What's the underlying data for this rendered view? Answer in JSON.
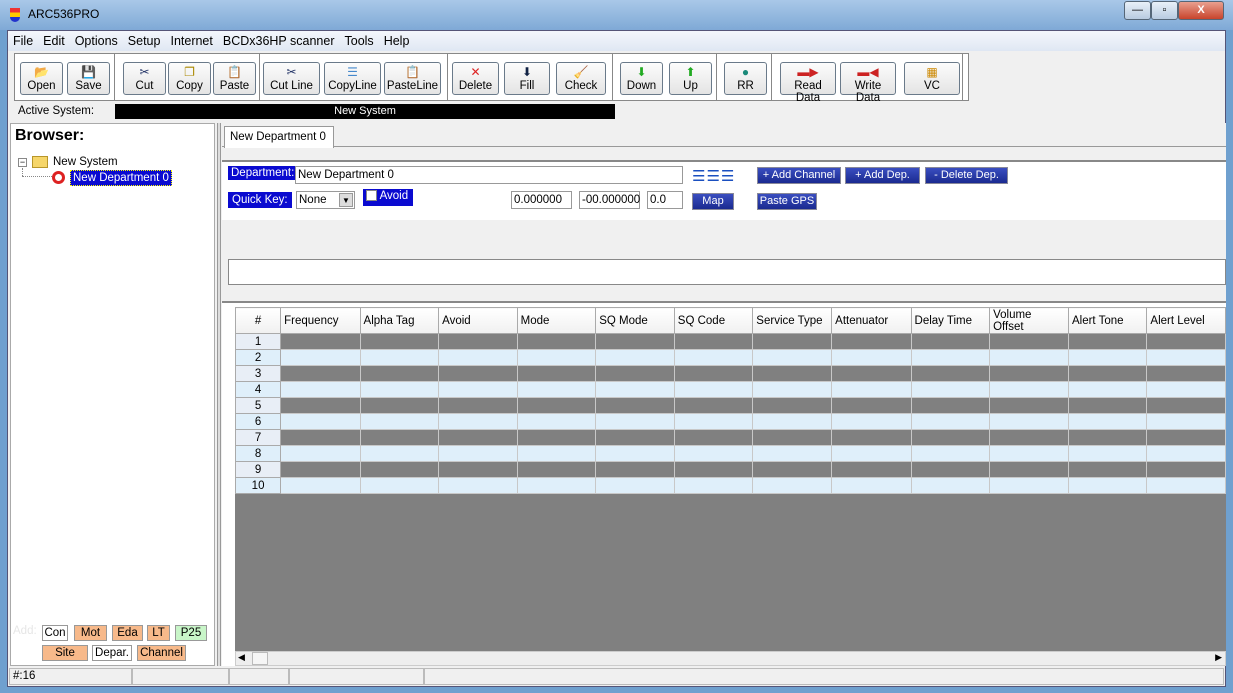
{
  "window": {
    "title": "ARC536PRO",
    "min": "—",
    "max": "▫",
    "close": "X"
  },
  "menu": [
    "File",
    "Edit",
    "Options",
    "Setup",
    "Internet",
    "BCDx36HP scanner",
    "Tools",
    "Help"
  ],
  "toolbar": [
    {
      "label": "Open",
      "icon": "folder-open-icon",
      "glyph": "📂"
    },
    {
      "label": "Save",
      "icon": "floppy-icon",
      "glyph": "💾"
    },
    {
      "label": "Cut",
      "icon": "scissors-icon",
      "glyph": "✂"
    },
    {
      "label": "Copy",
      "icon": "copy-icon",
      "glyph": "❐"
    },
    {
      "label": "Paste",
      "icon": "paste-icon",
      "glyph": "📋"
    },
    {
      "label": "Cut Line",
      "icon": "cut-line-icon",
      "glyph": "✂"
    },
    {
      "label": "CopyLine",
      "icon": "copy-line-icon",
      "glyph": "☰"
    },
    {
      "label": "PasteLine",
      "icon": "paste-line-icon",
      "glyph": "📋"
    },
    {
      "label": "Delete",
      "icon": "delete-x-icon",
      "glyph": "✕"
    },
    {
      "label": "Fill",
      "icon": "fill-down-icon",
      "glyph": "⬇"
    },
    {
      "label": "Check",
      "icon": "check-broom-icon",
      "glyph": "🧹"
    },
    {
      "label": "Down",
      "icon": "arrow-down-icon",
      "glyph": "⬇"
    },
    {
      "label": "Up",
      "icon": "arrow-up-icon",
      "glyph": "⬆"
    },
    {
      "label": "RR",
      "icon": "globe-icon",
      "glyph": "●"
    },
    {
      "label": "Read Data",
      "icon": "read-data-icon",
      "glyph": "▬▶"
    },
    {
      "label": "Write Data",
      "icon": "write-data-icon",
      "glyph": "▬◀"
    },
    {
      "label": "VC",
      "icon": "vc-grid-icon",
      "glyph": "▦"
    }
  ],
  "active_system": {
    "label": "Active System:",
    "value": "New System"
  },
  "browser": {
    "title": "Browser:",
    "tree": {
      "root": "New System",
      "child": "New Department 0"
    },
    "add_label": "Add:",
    "add_buttons": [
      "Con",
      "Mot",
      "Eda",
      "LT",
      "P25",
      "Site",
      "Depar.",
      "Channel"
    ]
  },
  "tab": "New Department 0",
  "department": {
    "label": "Department:",
    "name": "New Department 0",
    "quick_key_label": "Quick Key:",
    "quick_key": "None",
    "avoid": "Avoid",
    "avoid_checked": false,
    "lat": "0.000000",
    "lon": "-00.000000",
    "range": "0.0",
    "map": "Map",
    "paste_gps": "Paste GPS",
    "add_channel": "+ Add Channel",
    "add_dep": "+ Add Dep.",
    "delete_dep": "- Delete Dep."
  },
  "grid": {
    "columns": [
      "#",
      "Frequency",
      "Alpha Tag",
      "Avoid",
      "Mode",
      "SQ Mode",
      "SQ Code",
      "Service Type",
      "Attenuator",
      "Delay Time",
      "Volume Offset",
      "Alert Tone",
      "Alert Level"
    ],
    "rows": [
      "1",
      "2",
      "3",
      "4",
      "5",
      "6",
      "7",
      "8",
      "9",
      "10"
    ]
  },
  "status": {
    "count": "#:16"
  },
  "colors": {
    "accent": "#0a0ad0",
    "orange_btn": "#f7b98a",
    "green_btn": "#c8f5c8",
    "grid_alt": "#dfeffa",
    "empty_area": "#808080"
  }
}
